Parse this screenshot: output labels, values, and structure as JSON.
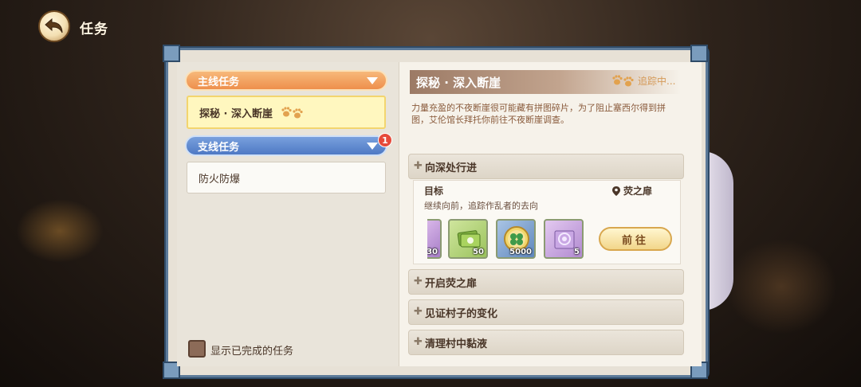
{
  "header": {
    "title": "任务"
  },
  "left": {
    "main_category": "主线任务",
    "side_category": "支线任务",
    "side_badge": "1",
    "main_quests": [
      {
        "label": "探秘 · 深入断崖"
      }
    ],
    "side_quests": [
      {
        "label": "防火防爆"
      }
    ],
    "show_completed_label": "显示已完成的任务"
  },
  "quest": {
    "title": "探秘 · 深入断崖",
    "tracking_label": "追踪中...",
    "description": "力量充盈的不夜断崖很可能藏有拼图碎片，为了阻止塞西尔得到拼图，艾伦馆长拜托你前往不夜断崖调查。",
    "steps": [
      {
        "label": "向深处行进"
      },
      {
        "label": "开启荧之扉"
      },
      {
        "label": "见证村子的变化"
      },
      {
        "label": "清理村中黏液"
      }
    ],
    "goal_label": "目标",
    "goal_location": "荧之扉",
    "goal_text": "继续向前，追踪作乱者的去向",
    "rewards": [
      {
        "icon": "partial-reward-icon",
        "count": "30"
      },
      {
        "icon": "ticket-stack-icon",
        "count": "50"
      },
      {
        "icon": "clover-coin-icon",
        "count": "5000"
      },
      {
        "icon": "spellbook-icon",
        "count": "5"
      }
    ],
    "go_button": "前往"
  },
  "colors": {
    "main_category": "#ee8f4c",
    "side_category": "#4e79c4",
    "badge": "#e64a3a",
    "frame": "#5c7a99"
  }
}
